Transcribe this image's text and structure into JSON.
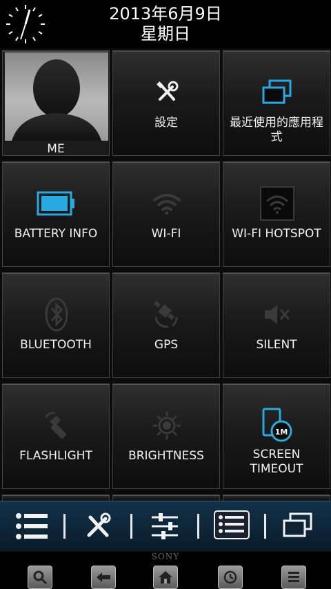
{
  "header": {
    "date": "2013年6月9日",
    "weekday": "星期日"
  },
  "tiles": [
    {
      "label": "ME",
      "icon": "contact-silhouette-icon"
    },
    {
      "label": "設定",
      "icon": "tools-icon"
    },
    {
      "label": "最近使用的應用程式",
      "icon": "recent-apps-icon"
    },
    {
      "label": "BATTERY INFO",
      "icon": "battery-icon"
    },
    {
      "label": "WI-FI",
      "icon": "wifi-icon"
    },
    {
      "label": "WI-FI HOTSPOT",
      "icon": "wifi-hotspot-icon"
    },
    {
      "label": "BLUETOOTH",
      "icon": "bluetooth-icon"
    },
    {
      "label": "GPS",
      "icon": "gps-satellite-icon"
    },
    {
      "label": "SILENT",
      "icon": "speaker-muted-icon"
    },
    {
      "label": "FLASHLIGHT",
      "icon": "flashlight-icon"
    },
    {
      "label": "BRIGHTNESS",
      "icon": "sun-icon"
    },
    {
      "label": "SCREEN TIMEOUT",
      "icon": "screen-timeout-icon",
      "badge": "1M"
    }
  ],
  "brand": "SONY",
  "colors": {
    "accent": "#29a9e1",
    "tile_top": "#2f2f2f",
    "tile_bottom": "#0d0d0d",
    "appbar": "#12324a"
  }
}
